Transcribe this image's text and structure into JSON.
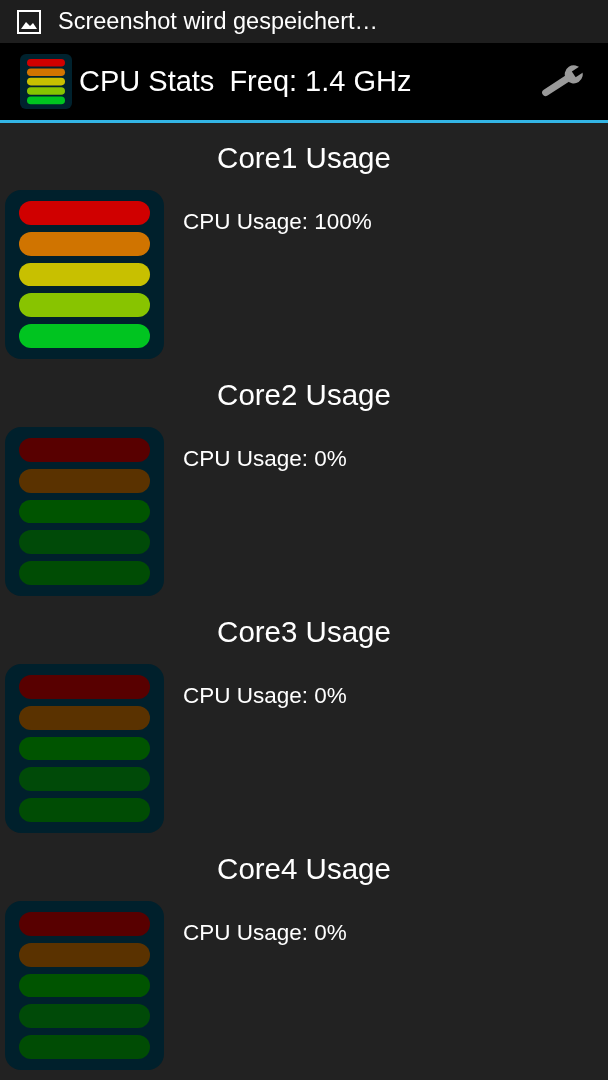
{
  "status_bar": {
    "notification": "Screenshot wird gespeichert…"
  },
  "action_bar": {
    "title": "CPU Stats",
    "frequency": "Freq: 1.4 GHz"
  },
  "cores": [
    {
      "title": "Core1 Usage",
      "usage": "CPU Usage: 100%",
      "bars": [
        {
          "lit": true
        },
        {
          "lit": true
        },
        {
          "lit": true
        },
        {
          "lit": true
        },
        {
          "lit": true
        }
      ]
    },
    {
      "title": "Core2 Usage",
      "usage": "CPU Usage: 0%",
      "bars": [
        {
          "lit": false
        },
        {
          "lit": false
        },
        {
          "lit": false
        },
        {
          "lit": false
        },
        {
          "lit": false
        }
      ]
    },
    {
      "title": "Core3 Usage",
      "usage": "CPU Usage: 0%",
      "bars": [
        {
          "lit": false
        },
        {
          "lit": false
        },
        {
          "lit": false
        },
        {
          "lit": false
        },
        {
          "lit": false
        }
      ]
    },
    {
      "title": "Core4 Usage",
      "usage": "CPU Usage: 0%",
      "bars": [
        {
          "lit": false
        },
        {
          "lit": false
        },
        {
          "lit": false
        },
        {
          "lit": false
        },
        {
          "lit": false
        }
      ]
    }
  ]
}
